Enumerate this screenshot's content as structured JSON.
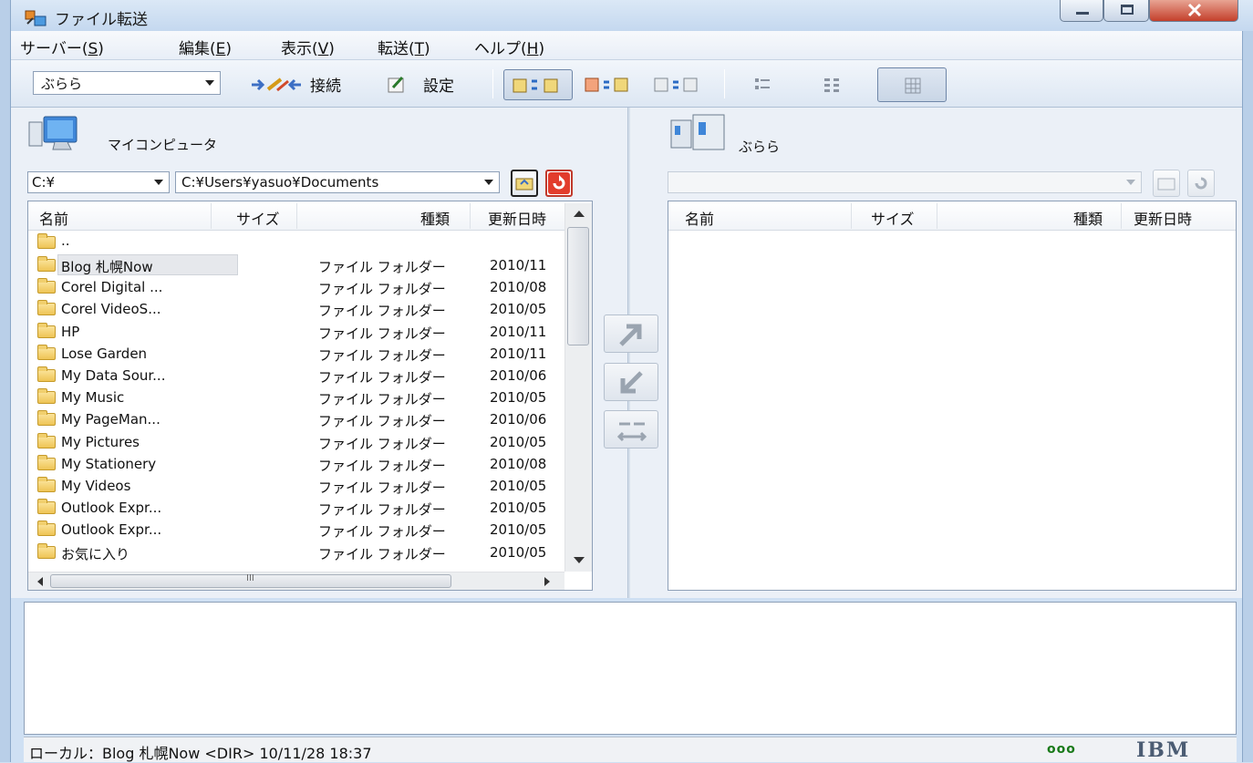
{
  "window": {
    "title": "ファイル転送"
  },
  "menu": [
    {
      "label": "サーバー(",
      "key": "S",
      "tail": ")"
    },
    {
      "label": "編集(",
      "key": "E",
      "tail": ")"
    },
    {
      "label": "表示(",
      "key": "V",
      "tail": ")"
    },
    {
      "label": "転送(",
      "key": "T",
      "tail": ")"
    },
    {
      "label": "ヘルプ(",
      "key": "H",
      "tail": ")"
    }
  ],
  "toolbar": {
    "server_select": "ぶらら",
    "connect_label": "接続",
    "settings_label": "設定"
  },
  "local": {
    "title": "マイコンピュータ",
    "drive": "C:¥",
    "path": "C:¥Users¥yasuo¥Documents",
    "columns": [
      "名前",
      "サイズ",
      "種類",
      "更新日時"
    ],
    "parent_label": "..",
    "rows": [
      {
        "name": "Blog 札幌Now",
        "size": "",
        "type": "ファイル フォルダー",
        "date": "2010/11"
      },
      {
        "name": "Corel Digital ...",
        "size": "",
        "type": "ファイル フォルダー",
        "date": "2010/08"
      },
      {
        "name": "Corel VideoS...",
        "size": "",
        "type": "ファイル フォルダー",
        "date": "2010/05"
      },
      {
        "name": "HP",
        "size": "",
        "type": "ファイル フォルダー",
        "date": "2010/11"
      },
      {
        "name": "Lose Garden",
        "size": "",
        "type": "ファイル フォルダー",
        "date": "2010/11"
      },
      {
        "name": "My Data Sour...",
        "size": "",
        "type": "ファイル フォルダー",
        "date": "2010/06"
      },
      {
        "name": "My Music",
        "size": "",
        "type": "ファイル フォルダー",
        "date": "2010/05"
      },
      {
        "name": "My PageMan...",
        "size": "",
        "type": "ファイル フォルダー",
        "date": "2010/06"
      },
      {
        "name": "My Pictures",
        "size": "",
        "type": "ファイル フォルダー",
        "date": "2010/05"
      },
      {
        "name": "My Stationery",
        "size": "",
        "type": "ファイル フォルダー",
        "date": "2010/08"
      },
      {
        "name": "My Videos",
        "size": "",
        "type": "ファイル フォルダー",
        "date": "2010/05"
      },
      {
        "name": "Outlook Expr...",
        "size": "",
        "type": "ファイル フォルダー",
        "date": "2010/05"
      },
      {
        "name": "Outlook Expr...",
        "size": "",
        "type": "ファイル フォルダー",
        "date": "2010/05"
      },
      {
        "name": "お気に入り",
        "size": "",
        "type": "ファイル フォルダー",
        "date": "2010/05"
      }
    ],
    "hscroll_mark": "III"
  },
  "remote": {
    "title": "ぶらら",
    "path": "",
    "columns": [
      "名前",
      "サイズ",
      "種類",
      "更新日時"
    ]
  },
  "status": {
    "text": "ローカル：Blog 札幌Now <DIR> 10/11/28 18:37",
    "dots": "ooo",
    "brand": "IBM"
  }
}
